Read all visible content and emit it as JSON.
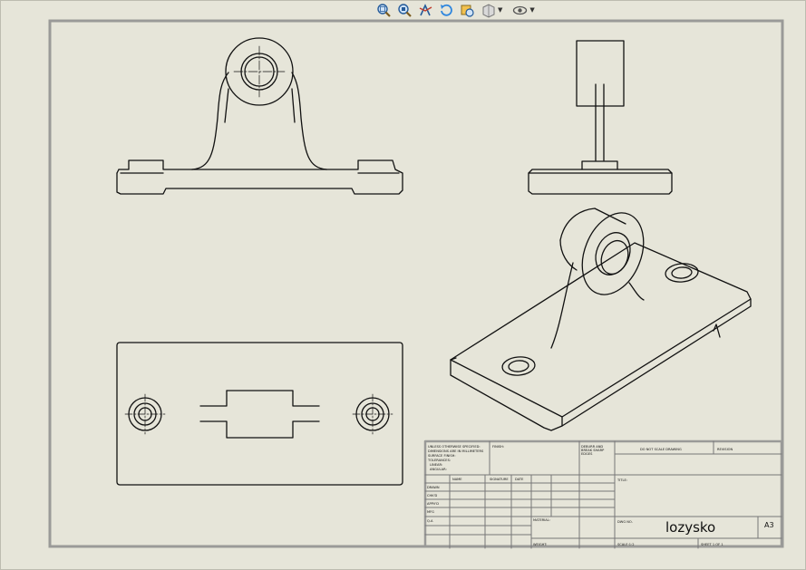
{
  "toolbar": {
    "buttons": [
      {
        "name": "zoom-to-fit-icon"
      },
      {
        "name": "zoom-to-area-icon"
      },
      {
        "name": "previous-view-icon"
      },
      {
        "name": "rotate-view-icon"
      },
      {
        "name": "pan-view-icon"
      },
      {
        "name": "display-style-icon"
      },
      {
        "name": "hide-show-items-icon"
      }
    ]
  },
  "title_block": {
    "notes": [
      "UNLESS OTHERWISE SPECIFIED:",
      "DIMENSIONS ARE IN MILLIMETERS",
      "SURFACE FINISH:",
      "TOLERANCES:",
      "LINEAR:",
      "ANGULAR:"
    ],
    "finish": "FINISH:",
    "deburr": [
      "DEBURR AND",
      "BREAK SHARP",
      "EDGES"
    ],
    "dont_scale": "DO NOT SCALE DRAWING",
    "revision": "REVISION",
    "col_name": "NAME",
    "col_signature": "SIGNATURE",
    "col_date": "DATE",
    "rows": [
      "DRAWN",
      "CHK'D",
      "APPV'D",
      "MFG",
      "Q.A"
    ],
    "material": "MATERIAL:",
    "weight": "WEIGHT:",
    "title_label": "TITLE:",
    "dwg_no": "DWG NO.",
    "scale": "SCALE:1:2",
    "sheet": "SHEET 1 OF 1",
    "part_name": "lozysko",
    "size": "A3"
  }
}
